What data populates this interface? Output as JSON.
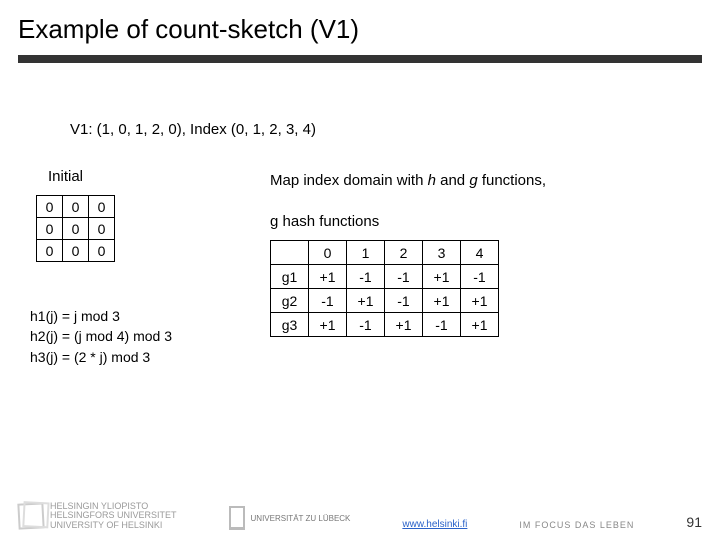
{
  "title": "Example of count-sketch (V1)",
  "v1_line": "V1: (1, 0, 1, 2, 0), Index (0, 1, 2, 3, 4)",
  "initial_label": "Initial",
  "initial_table": [
    [
      "0",
      "0",
      "0"
    ],
    [
      "0",
      "0",
      "0"
    ],
    [
      "0",
      "0",
      "0"
    ]
  ],
  "map_label_pre": "Map index domain with ",
  "map_h": "h",
  "map_and": " and ",
  "map_g": "g",
  "map_label_post": " functions,",
  "g_label": "g hash functions",
  "chart_data": {
    "type": "table",
    "title": "g hash functions",
    "columns": [
      "0",
      "1",
      "2",
      "3",
      "4"
    ],
    "rows": [
      "g1",
      "g2",
      "g3"
    ],
    "values": [
      [
        "+1",
        "-1",
        "-1",
        "+1",
        "-1"
      ],
      [
        "-1",
        "+1",
        "-1",
        "+1",
        "+1"
      ],
      [
        "+1",
        "-1",
        "+1",
        "-1",
        "+1"
      ]
    ]
  },
  "hash_defs": [
    "h1(j) = j mod 3",
    "h2(j) = (j mod 4) mod 3",
    "h3(j) = (2 * j) mod 3"
  ],
  "footer": {
    "helsinki_line1": "HELSINGIN YLIOPISTO",
    "helsinki_line2": "HELSINGFORS UNIVERSITET",
    "helsinki_line3": "UNIVERSITY OF HELSINKI",
    "lubeck": "UNIVERSITÄT ZU LÜBECK",
    "link": "www.helsinki.fi",
    "tagline": "IM FOCUS DAS LEBEN",
    "page_num": "91"
  }
}
